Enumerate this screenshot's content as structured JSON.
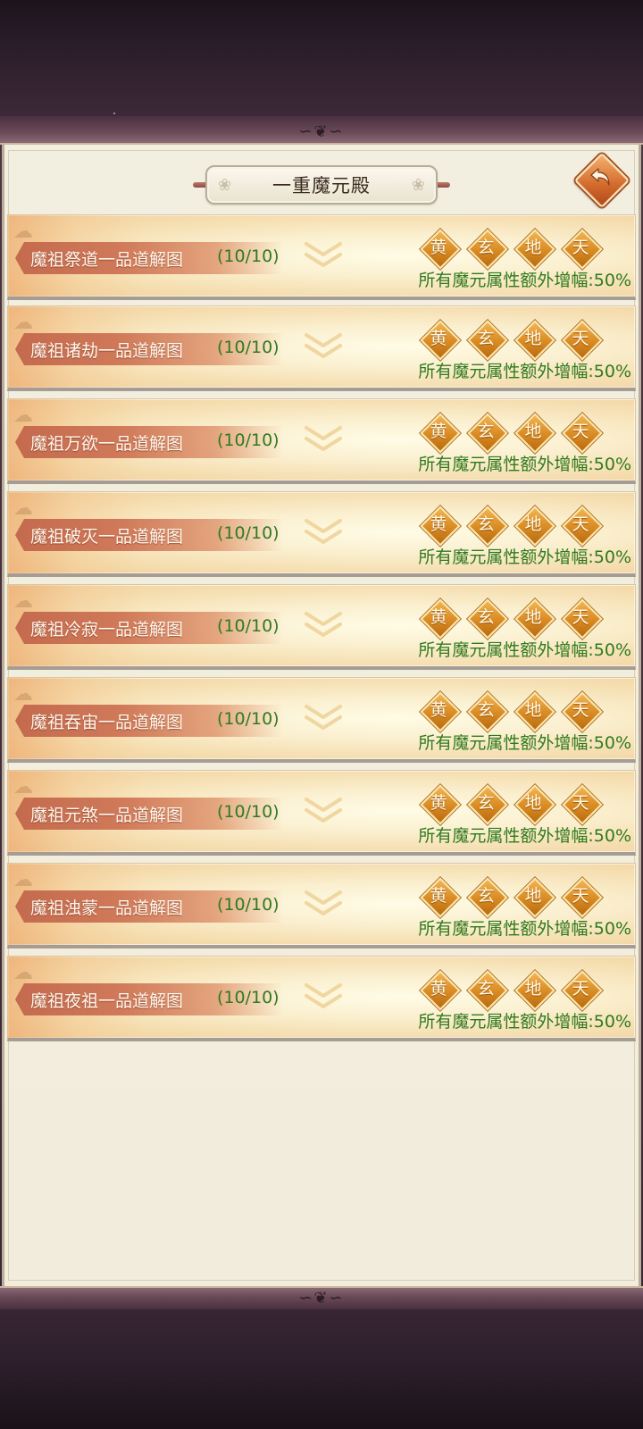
{
  "header": {
    "title": "一重魔元殿"
  },
  "tier_badges": [
    "黄",
    "玄",
    "地",
    "天"
  ],
  "rows": [
    {
      "name": "魔祖祭道一品道解图",
      "count": "(10/10)",
      "bonus": "所有魔元属性额外增幅:50%"
    },
    {
      "name": "魔祖诸劫一品道解图",
      "count": "(10/10)",
      "bonus": "所有魔元属性额外增幅:50%"
    },
    {
      "name": "魔祖万欲一品道解图",
      "count": "(10/10)",
      "bonus": "所有魔元属性额外增幅:50%"
    },
    {
      "name": "魔祖破灭一品道解图",
      "count": "(10/10)",
      "bonus": "所有魔元属性额外增幅:50%"
    },
    {
      "name": "魔祖冷寂一品道解图",
      "count": "(10/10)",
      "bonus": "所有魔元属性额外增幅:50%"
    },
    {
      "name": "魔祖吞宙一品道解图",
      "count": "(10/10)",
      "bonus": "所有魔元属性额外增幅:50%"
    },
    {
      "name": "魔祖元煞一品道解图",
      "count": "(10/10)",
      "bonus": "所有魔元属性额外增幅:50%"
    },
    {
      "name": "魔祖浊蒙一品道解图",
      "count": "(10/10)",
      "bonus": "所有魔元属性额外增幅:50%"
    },
    {
      "name": "魔祖夜祖一品道解图",
      "count": "(10/10)",
      "bonus": "所有魔元属性额外增幅:50%"
    }
  ],
  "colors": {
    "accent_green": "#2f7a1e",
    "ribbon": "#c46a4e",
    "badge_gold": "#d98a22"
  },
  "icons": {
    "back": "back-arrow-icon",
    "expand": "chevron-down-icon"
  }
}
